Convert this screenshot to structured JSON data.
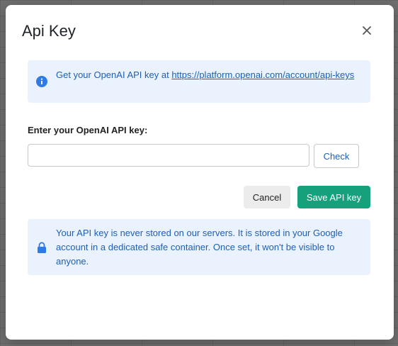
{
  "modal": {
    "title": "Api Key",
    "close_icon": "close-icon"
  },
  "info": {
    "icon": "info-icon",
    "prefix": "Get your OpenAI API key at ",
    "link_text": "https://platform.openai.com/account/api-keys"
  },
  "form": {
    "label": "Enter your OpenAI API key:",
    "input_value": "",
    "input_placeholder": "",
    "check_label": "Check"
  },
  "actions": {
    "cancel_label": "Cancel",
    "save_label": "Save API key"
  },
  "privacy": {
    "icon": "lock-icon",
    "text": "Your API key is never stored on our servers. It is stored in your Google account in a dedicated safe container. Once set, it won't be visible to anyone."
  },
  "colors": {
    "accent_blue": "#1e5fb5",
    "info_background": "#eaf2fd",
    "save_green": "#16a07c"
  }
}
